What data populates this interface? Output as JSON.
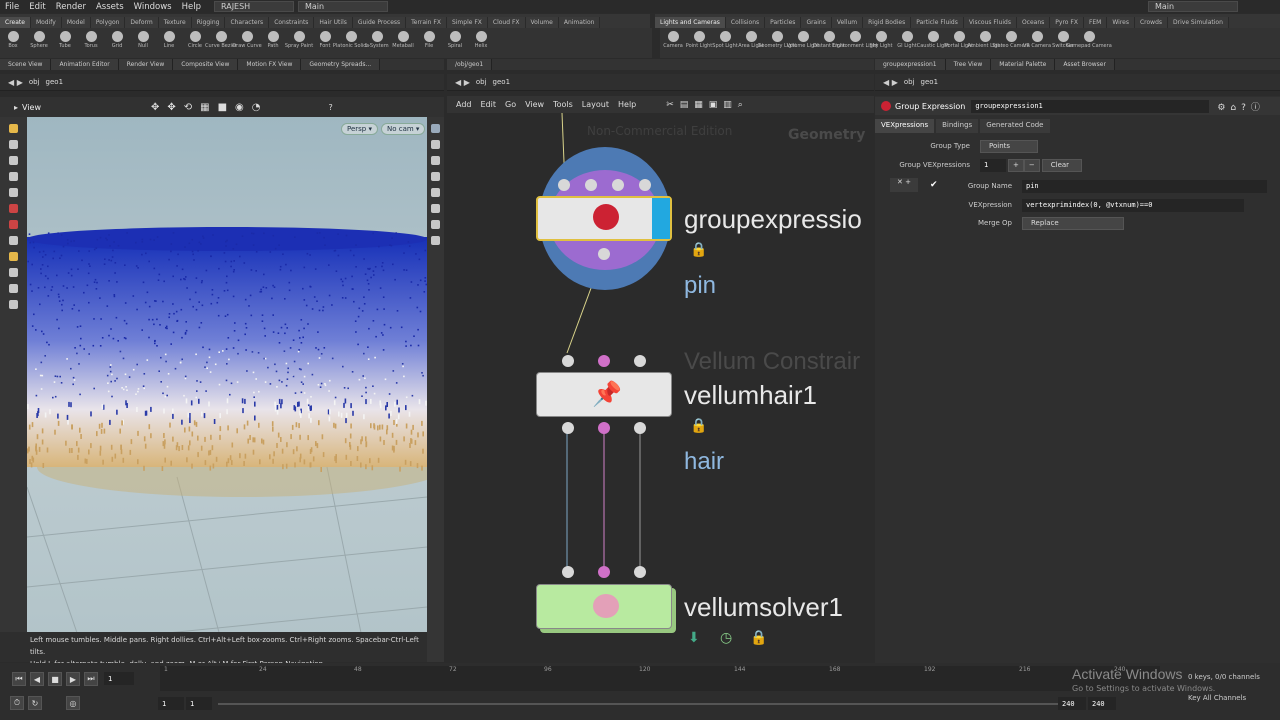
{
  "menubar": {
    "items": [
      "File",
      "Edit",
      "Render",
      "Assets",
      "Windows",
      "Help"
    ],
    "user": "RAJESH",
    "desktop": "Main",
    "desktop_right": "Main"
  },
  "shelf_left": {
    "tabs": [
      "Create",
      "Modify",
      "Model",
      "Polygon",
      "Deform",
      "Texture",
      "Rigging",
      "Characters",
      "Constraints",
      "Hair Utils",
      "Guide Process",
      "Terrain FX",
      "Simple FX",
      "Cloud FX",
      "Volume",
      "Animation"
    ],
    "tools": [
      "Box",
      "Sphere",
      "Tube",
      "Torus",
      "Grid",
      "Null",
      "Line",
      "Circle",
      "Curve Bezier",
      "Draw Curve",
      "Path",
      "Spray Paint",
      "Font",
      "Platonic Solids",
      "L-System",
      "Metaball",
      "File",
      "Spiral",
      "Helix"
    ]
  },
  "shelf_right": {
    "tabs": [
      "Lights and Cameras",
      "Collisions",
      "Particles",
      "Grains",
      "Vellum",
      "Rigid Bodies",
      "Particle Fluids",
      "Viscous Fluids",
      "Oceans",
      "Pyro FX",
      "FEM",
      "Wires",
      "Crowds",
      "Drive Simulation"
    ],
    "tools": [
      "Camera",
      "Point Light",
      "Spot Light",
      "Area Light",
      "Geometry Light",
      "Volume Light",
      "Distant Light",
      "Environment Light",
      "Sky Light",
      "GI Light",
      "Caustic Light",
      "Portal Light",
      "Ambient Light",
      "Stereo Camera",
      "VR Camera",
      "Switcher",
      "Gamepad Camera"
    ]
  },
  "left_pane": {
    "tabs": [
      "Scene View",
      "Animation Editor",
      "Render View",
      "Composite View",
      "Motion FX View",
      "Geometry Spreads..."
    ],
    "path": [
      "obj",
      "geo1"
    ],
    "view_label": "View",
    "persp": "Persp",
    "cam": "No cam",
    "hint_line1": "Left mouse tumbles. Middle pans. Right dollies. Ctrl+Alt+Left box-zooms. Ctrl+Right zooms. Spacebar-Ctrl-Left tilts.",
    "hint_line2": "Hold L for alternate tumble, dolly, and zoom.     M or Alt+M for First Person Navigation."
  },
  "network": {
    "tab": "/obj/geo1",
    "path": [
      "obj",
      "geo1"
    ],
    "menu": [
      "Add",
      "Edit",
      "Go",
      "View",
      "Tools",
      "Layout",
      "Help"
    ],
    "watermark": "Non-Commercial Edition",
    "context": "Geometry",
    "nodes": [
      {
        "name": "groupexpression1",
        "display_name": "groupexpressio",
        "flag": "pin",
        "color": "#e7e7e7"
      },
      {
        "name": "vellumhair1",
        "display_name": "vellumhair1",
        "type_label": "Vellum Constrair",
        "flag": "hair",
        "color": "#e7e7e7"
      },
      {
        "name": "vellumsolver1",
        "display_name": "vellumsolver1",
        "color": "#b8eaa0"
      }
    ]
  },
  "params": {
    "tabs_top": [
      "groupexpression1",
      "Tree View",
      "Material Palette",
      "Asset Browser"
    ],
    "path": [
      "obj",
      "geo1"
    ],
    "node_type": "Group Expression",
    "node_name": "groupexpression1",
    "subtabs": [
      "VEXpressions",
      "Bindings",
      "Generated Code"
    ],
    "group_type_label": "Group Type",
    "group_type": "Points",
    "group_vex_label": "Group VEXpressions",
    "group_vex_count": "1",
    "clear": "Clear",
    "group_name_label": "Group Name",
    "group_name": "pin",
    "vex_label": "VEXpression",
    "vex": "vertexprimindex(0, @vtxnum)==0",
    "merge_label": "Merge Op",
    "merge": "Replace"
  },
  "timeline": {
    "ticks": [
      "1",
      "24",
      "48",
      "72",
      "96",
      "120",
      "144",
      "168",
      "192",
      "216",
      "240"
    ],
    "frame": "1",
    "start": "1",
    "start2": "1",
    "end": "240",
    "end2": "240",
    "keys": "0 keys, 0/0 channels",
    "key_all": "Key All Channels"
  },
  "os_watermark": {
    "line1": "Activate Windows",
    "line2": "Go to Settings to activate Windows."
  }
}
